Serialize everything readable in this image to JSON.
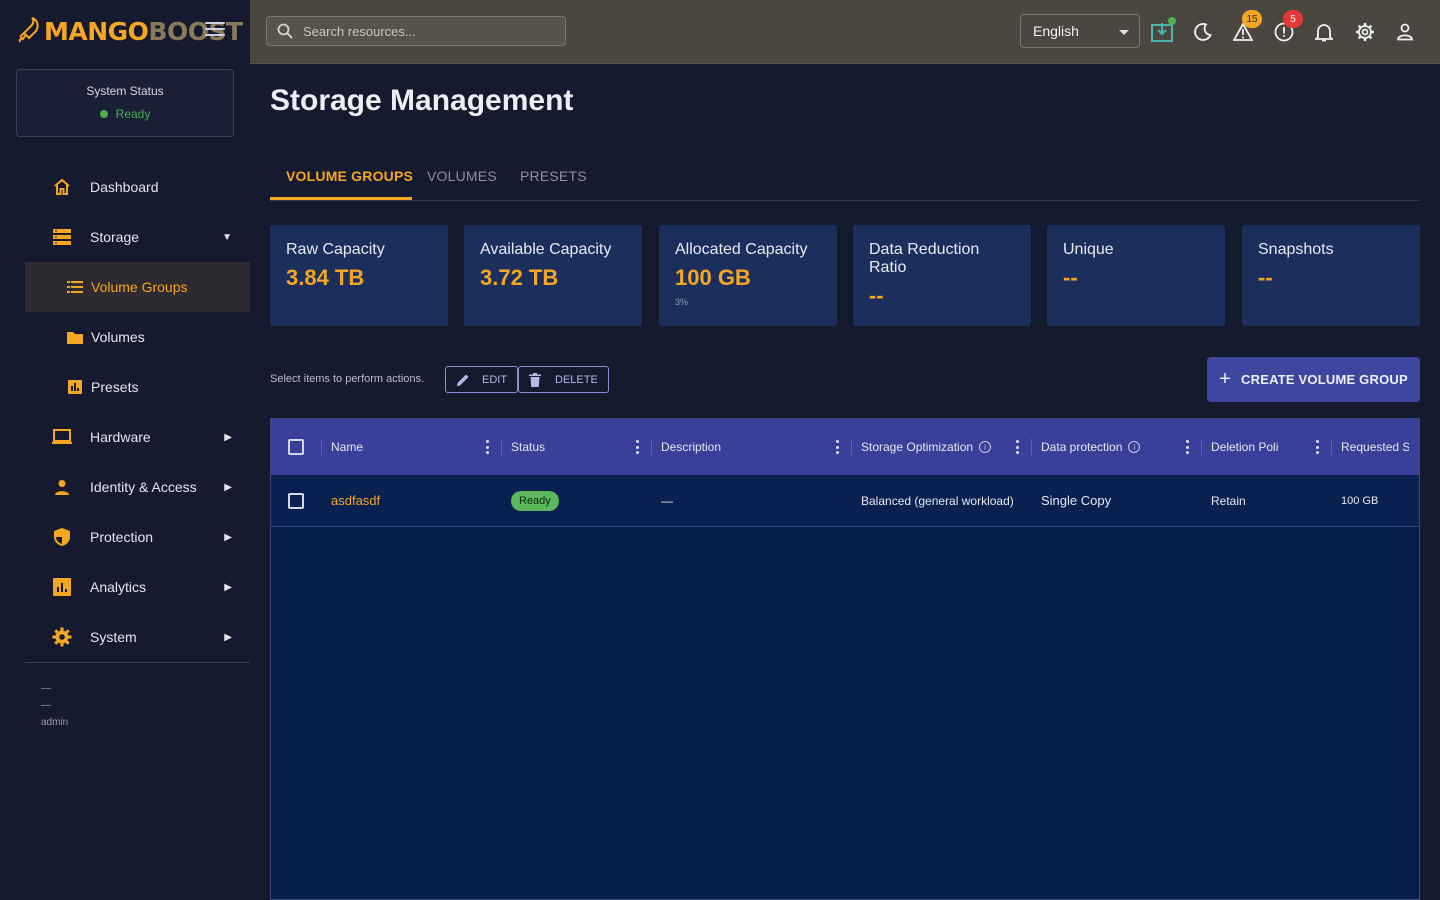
{
  "brand": {
    "name_part1": "MANGO",
    "name_part2": "BOOST"
  },
  "system_status": {
    "title": "System Status",
    "value": "Ready"
  },
  "sidebar": {
    "items": [
      {
        "label": "Dashboard",
        "icon": "home-icon"
      },
      {
        "label": "Storage",
        "icon": "storage-icon",
        "expanded": true
      },
      {
        "label": "Volume Groups",
        "icon": "list-icon",
        "active": true
      },
      {
        "label": "Volumes",
        "icon": "folder-icon"
      },
      {
        "label": "Presets",
        "icon": "bar-chart-icon"
      },
      {
        "label": "Hardware",
        "icon": "laptop-icon"
      },
      {
        "label": "Identity & Access",
        "icon": "person-icon"
      },
      {
        "label": "Protection",
        "icon": "shield-icon"
      },
      {
        "label": "Analytics",
        "icon": "analytics-icon"
      },
      {
        "label": "System",
        "icon": "gear-icon"
      }
    ],
    "user": {
      "line1": "—",
      "line2": "—",
      "username": "admin"
    }
  },
  "topbar": {
    "search_placeholder": "Search resources...",
    "language": "English",
    "warning_count": "15",
    "error_count": "5"
  },
  "page": {
    "title": "Storage Management",
    "tabs": [
      "VOLUME GROUPS",
      "VOLUMES",
      "PRESETS"
    ],
    "active_tab": 0
  },
  "stats": [
    {
      "label": "Raw Capacity",
      "value": "3.84 TB",
      "sub": ""
    },
    {
      "label": "Available Capacity",
      "value": "3.72 TB",
      "sub": ""
    },
    {
      "label": "Allocated Capacity",
      "value": "100 GB",
      "sub": "3%"
    },
    {
      "label": "Data Reduction Ratio",
      "value": "--",
      "sub": ""
    },
    {
      "label": "Unique",
      "value": "--",
      "sub": ""
    },
    {
      "label": "Snapshots",
      "value": "--",
      "sub": ""
    }
  ],
  "actions": {
    "hint": "Select items to perform actions.",
    "edit": "EDIT",
    "delete": "DELETE",
    "create": "CREATE VOLUME GROUP"
  },
  "table": {
    "columns": [
      "Name",
      "Status",
      "Description",
      "Storage Optimization",
      "Data protection",
      "Deletion Polic",
      "Requested Si:"
    ],
    "rows": [
      {
        "name": "asdfasdf",
        "status": "Ready",
        "description": "—",
        "optimization": "Balanced (general workload)",
        "protection": "Single Copy",
        "deletion": "Retain",
        "requested": "100 GB"
      }
    ]
  },
  "colors": {
    "accent": "#f5a623",
    "primary": "#3f46a0",
    "success": "#5cb85c",
    "danger": "#e53935"
  }
}
